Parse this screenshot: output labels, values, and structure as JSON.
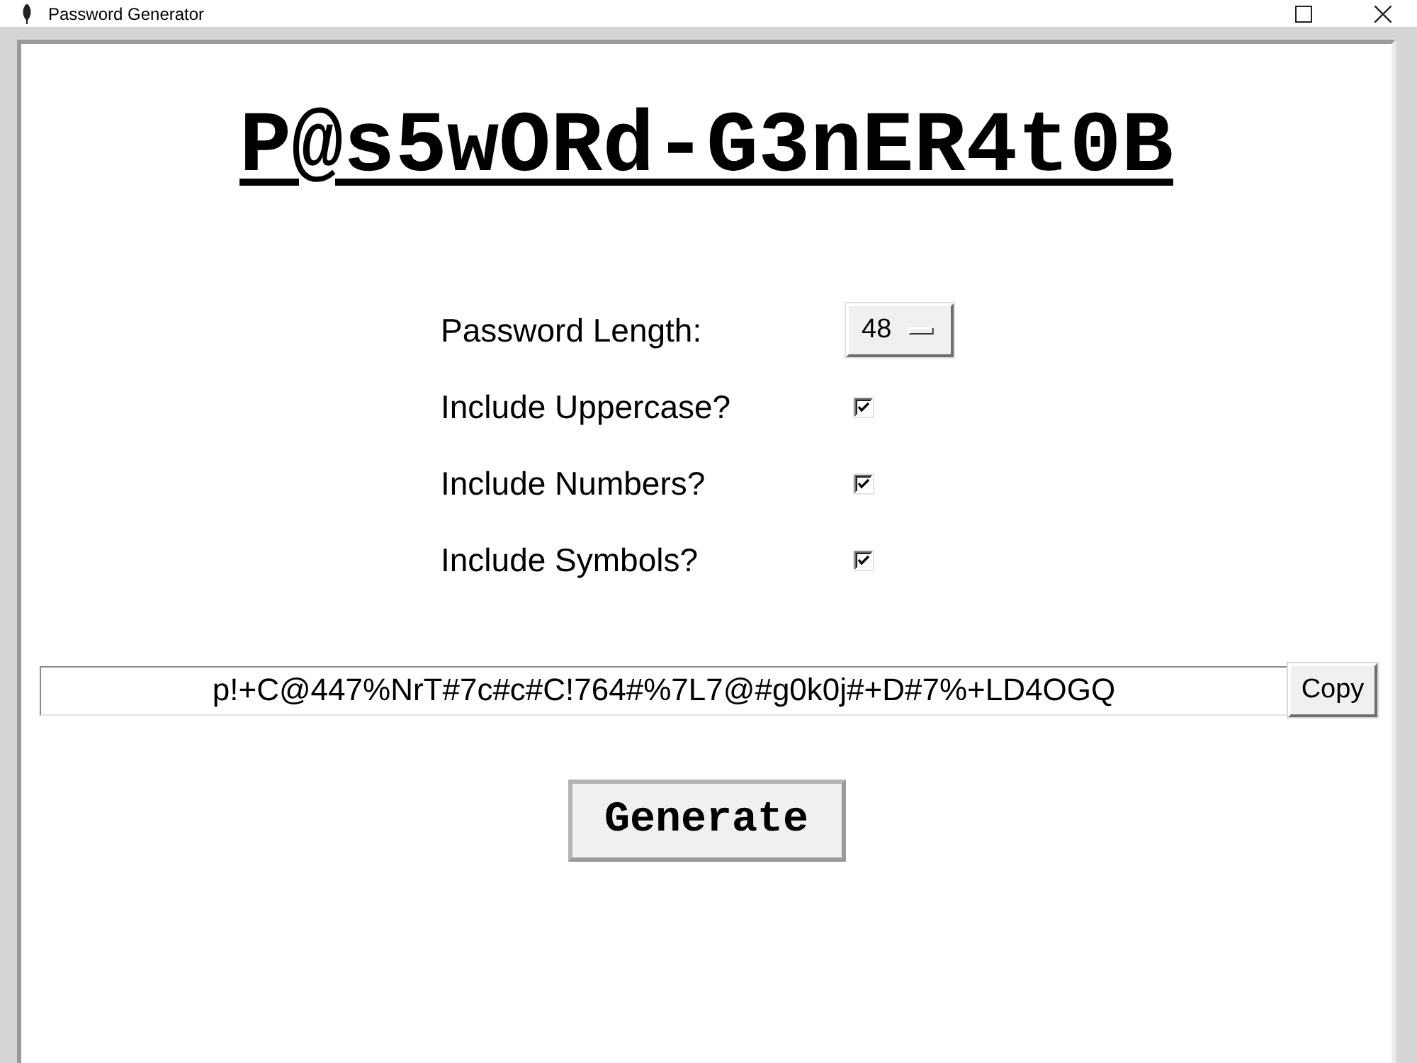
{
  "window": {
    "title": "Password Generator"
  },
  "heading": "P@s5wORd-G3nER4t0B",
  "options": [
    {
      "kind": "dropdown",
      "label": "Password Length:",
      "value": "48"
    },
    {
      "kind": "checkbox",
      "label": "Include Uppercase?",
      "checked": true
    },
    {
      "kind": "checkbox",
      "label": "Include Numbers?",
      "checked": true
    },
    {
      "kind": "checkbox",
      "label": "Include Symbols?",
      "checked": true
    }
  ],
  "password": {
    "value": "p!+C@447%NrT#7c#c#C!764#%7L7@#g0k0j#+D#7%+LD4OGQ"
  },
  "copy_button": "Copy",
  "generate_button": "Generate"
}
